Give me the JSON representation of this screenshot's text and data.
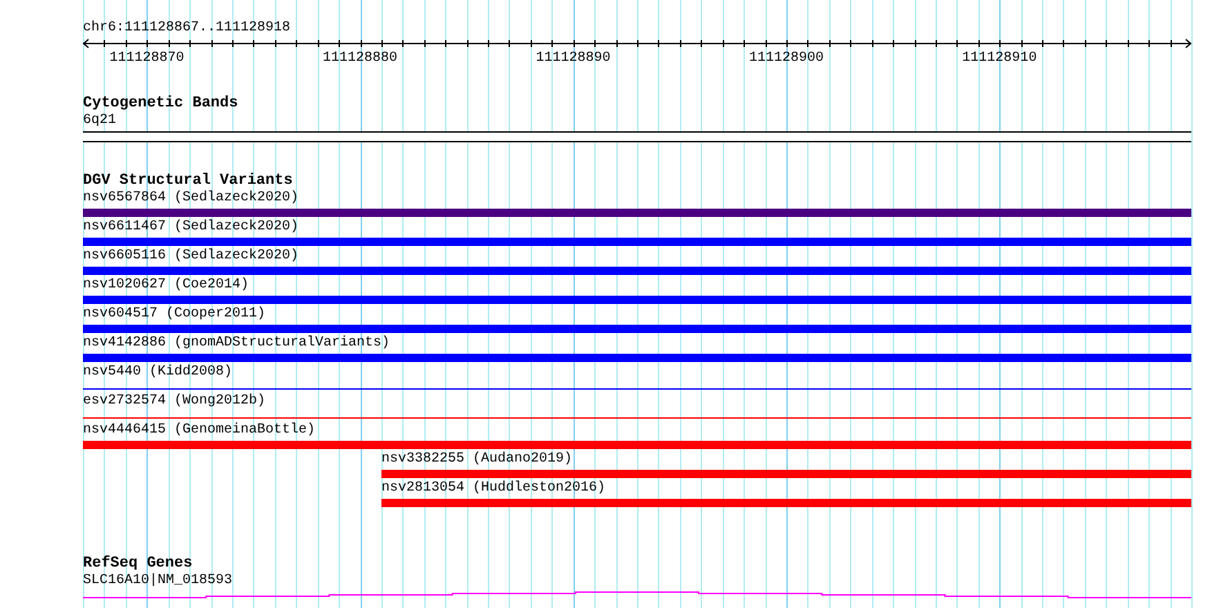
{
  "location": "chr6:111128867..111128918",
  "ruler": {
    "ticks": [
      "111128870",
      "111128880",
      "111128890",
      "111128900",
      "111128910"
    ]
  },
  "tracks": [
    {
      "kind": "bands",
      "title": "Cytogenetic Bands",
      "features": [
        {
          "label": "6q21"
        }
      ]
    },
    {
      "kind": "variants",
      "title": "DGV Structural Variants",
      "features": [
        {
          "label": "nsv6567864 (Sedlazeck2020)",
          "color": "#4b0082",
          "kind": "bar"
        },
        {
          "label": "nsv6611467 (Sedlazeck2020)",
          "color": "#0000ff",
          "kind": "bar"
        },
        {
          "label": "nsv6605116 (Sedlazeck2020)",
          "color": "#0000ff",
          "kind": "bar"
        },
        {
          "label": "nsv1020627 (Coe2014)",
          "color": "#0000ff",
          "kind": "bar"
        },
        {
          "label": "nsv604517 (Cooper2011)",
          "color": "#0000ff",
          "kind": "bar"
        },
        {
          "label": "nsv4142886 (gnomADStructuralVariants)",
          "color": "#0000ff",
          "kind": "bar"
        },
        {
          "label": "nsv5440 (Kidd2008)",
          "color": "#0000ff",
          "kind": "line"
        },
        {
          "label": "esv2732574 (Wong2012b)",
          "color": "#ff0000",
          "kind": "line"
        },
        {
          "label": "nsv4446415 (GenomeinaBottle)",
          "color": "#ff0000",
          "kind": "bar"
        },
        {
          "label": "nsv3382255 (Audano2019)",
          "color": "#ff0000",
          "kind": "partial"
        },
        {
          "label": "nsv2813054 (Huddleston2016)",
          "color": "#ff0000",
          "kind": "partial"
        }
      ]
    },
    {
      "kind": "genes",
      "title": "RefSeq Genes",
      "features": [
        {
          "label": "SLC16A10|NM_018593"
        }
      ]
    }
  ]
}
